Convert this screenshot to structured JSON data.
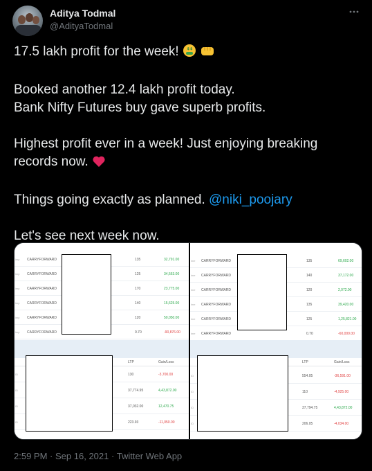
{
  "author": {
    "name": "Aditya Todmal",
    "handle": "@AdityaTodmal"
  },
  "more_icon": "more-options-icon",
  "tweet": {
    "line1": "17.5 lakh profit for the week!",
    "line1_emojis": [
      "money-mouth-face-emoji",
      "oncoming-fist-emoji"
    ],
    "line2": "Booked another 12.4 lakh profit today.",
    "line3": "Bank Nifty Futures buy gave superb profits.",
    "line4": "Highest profit ever in a week! Just enjoying breaking records now.",
    "line4_emoji": "red-heart-emoji",
    "line5_text": "Things going exactly as planned.",
    "line5_mention": "@niki_poojary",
    "line6": "Let's see next week now."
  },
  "screenshot_left": {
    "top_rows": [
      {
        "label": "CARRYFORWARD",
        "qty": "135",
        "pl": "32,791.00",
        "pl_color": "green"
      },
      {
        "label": "CARRYFORWARD",
        "qty": "125",
        "pl": "34,563.00",
        "pl_color": "green"
      },
      {
        "label": "CARRYFORWARD",
        "qty": "170",
        "pl": "23,775.00",
        "pl_color": "green"
      },
      {
        "label": "CARRYFORWARD",
        "qty": "140",
        "pl": "15,625.00",
        "pl_color": "green"
      },
      {
        "label": "CARRYFORWARD",
        "qty": "120",
        "pl": "50,050.00",
        "pl_color": "green"
      },
      {
        "label": "CARRYFORWARD",
        "qty": "0.70",
        "pl": "-90,876.00",
        "pl_color": "red"
      }
    ],
    "bottom_header": {
      "col1": "LTP",
      "col2": "Gain/Loss"
    },
    "bottom_rows": [
      {
        "ltp": "130",
        "gl": "-3,700.00",
        "gl_color": "red"
      },
      {
        "ltp": "37,774.95",
        "gl": "4,43,872.00",
        "gl_color": "green"
      },
      {
        "ltp": "37,032.00",
        "gl": "12,470.75",
        "gl_color": "green"
      },
      {
        "ltp": "223.93",
        "gl": "-11,050.00",
        "gl_color": "red"
      }
    ]
  },
  "screenshot_right": {
    "top_rows": [
      {
        "label": "CARRYFORWARD",
        "qty": "135",
        "pl": "69,602.00",
        "pl_color": "green"
      },
      {
        "label": "CARRYFORWARD",
        "qty": "140",
        "pl": "37,172.00",
        "pl_color": "green"
      },
      {
        "label": "CARRYFORWARD",
        "qty": "120",
        "pl": "2,072.00",
        "pl_color": "green"
      },
      {
        "label": "CARRYFORWARD",
        "qty": "135",
        "pl": "39,420.00",
        "pl_color": "green"
      },
      {
        "label": "CARRYFORWARD",
        "qty": "125",
        "pl": "1,25,821.00",
        "pl_color": "green"
      },
      {
        "label": "CARRYFORWARD",
        "qty": "0.70",
        "pl": "-60,000.00",
        "pl_color": "red"
      }
    ],
    "bottom_header": {
      "col1": "LTP",
      "col2": "Gain/Loss"
    },
    "bottom_rows": [
      {
        "ltp": "554.05",
        "gl": "-36,591.00",
        "gl_color": "red"
      },
      {
        "ltp": "110",
        "gl": "-4,925.00",
        "gl_color": "red"
      },
      {
        "ltp": "37,794.75",
        "gl": "4,43,872.00",
        "gl_color": "green"
      },
      {
        "ltp": "206.05",
        "gl": "-4,034.00",
        "gl_color": "red"
      }
    ]
  },
  "footer": {
    "time": "2:59 PM",
    "date": "Sep 16, 2021",
    "source": "Twitter Web App",
    "separator": "·"
  }
}
